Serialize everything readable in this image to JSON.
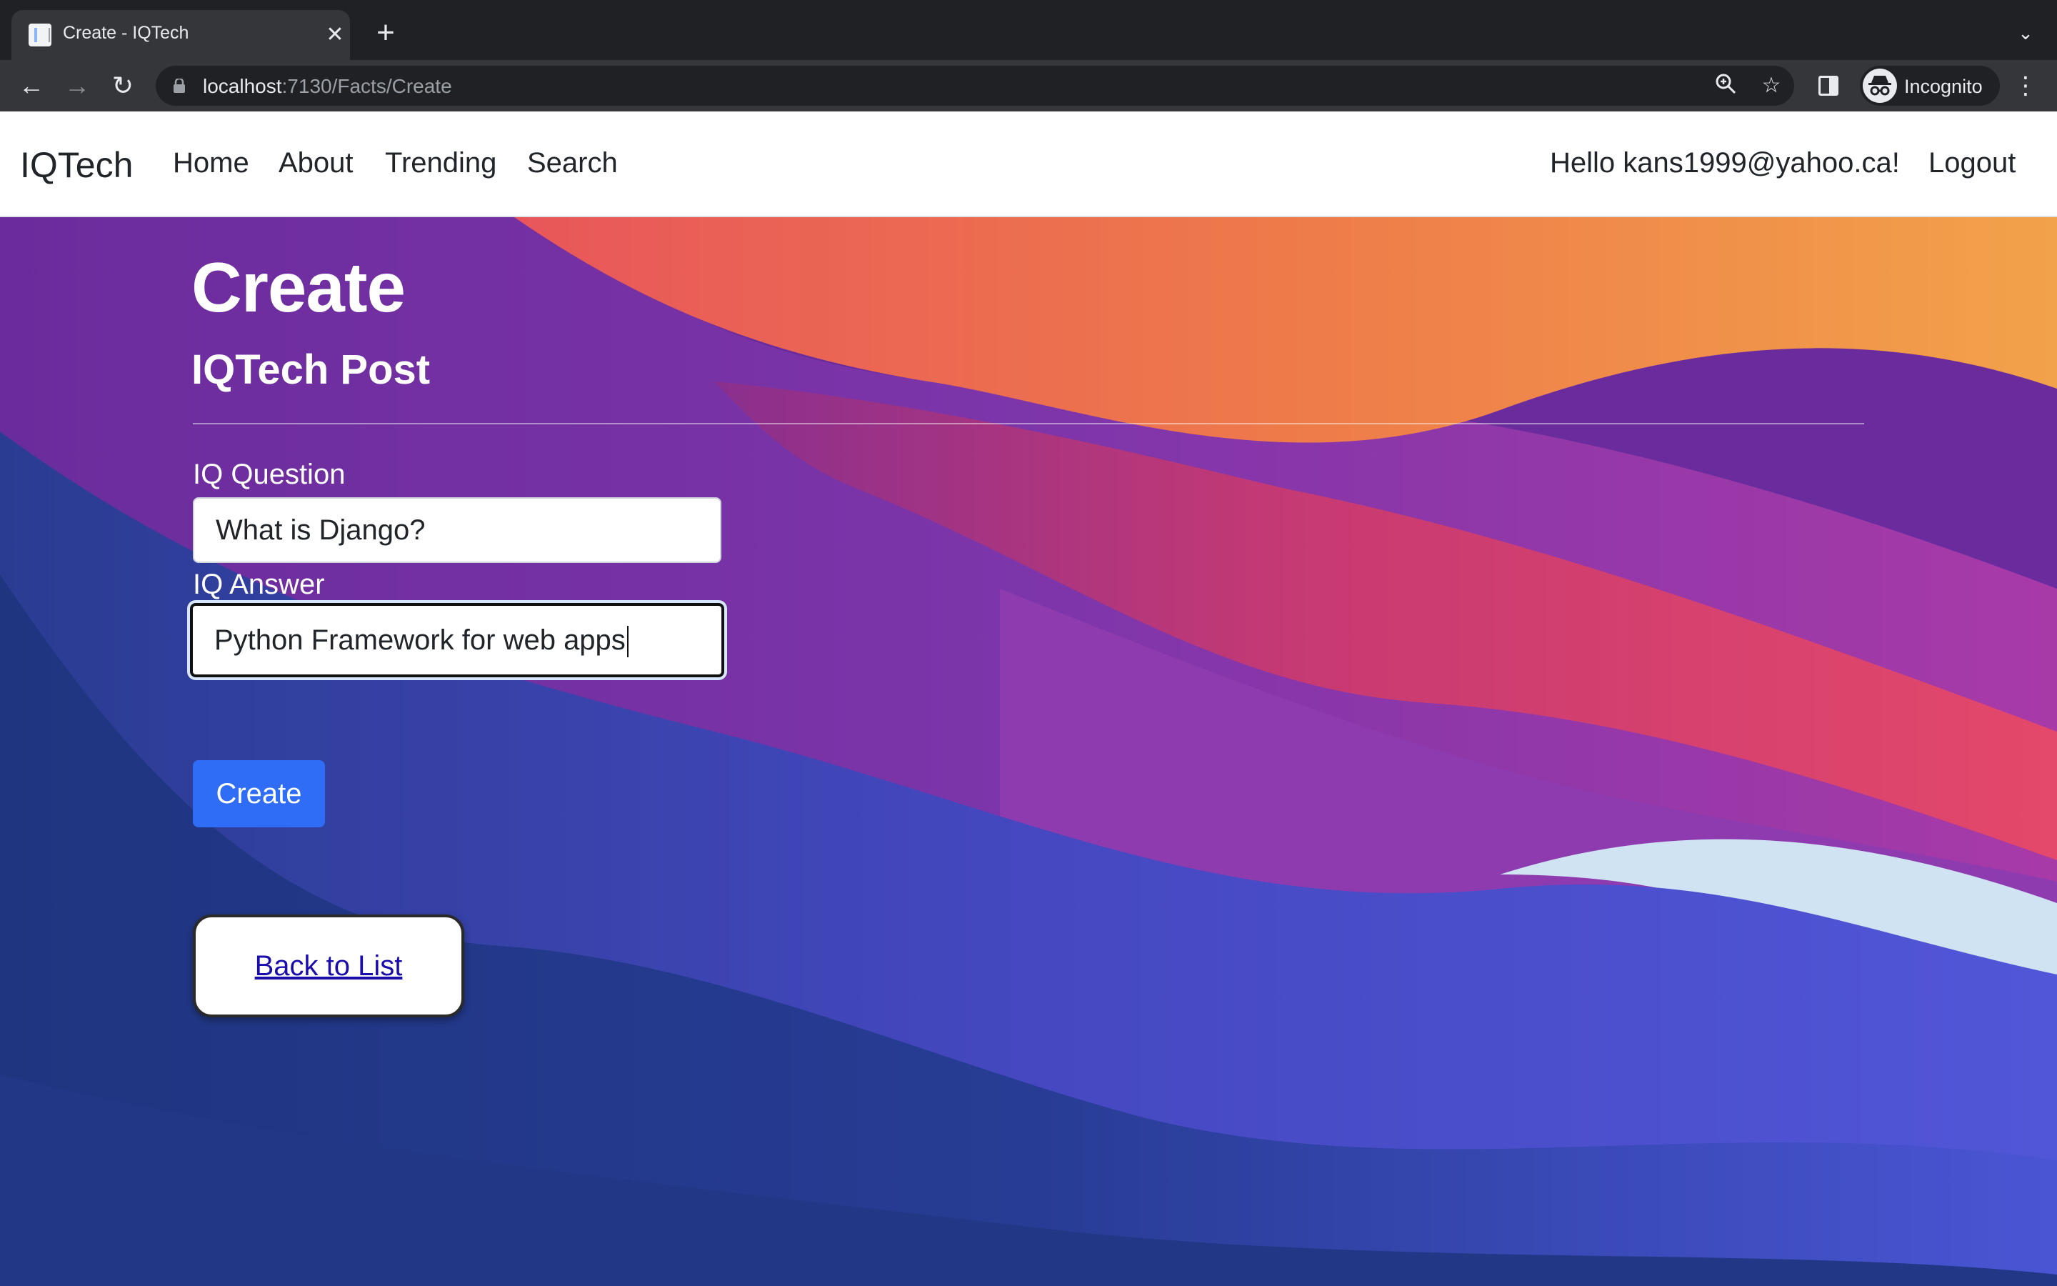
{
  "browser": {
    "tab_title": "Create - IQTech",
    "tab_close": "✕",
    "new_tab": "+",
    "tab_menu": "⌄",
    "url_host": "localhost",
    "url_path": ":7130/Facts/Create",
    "profile_label": "Incognito",
    "icons": [
      "back-icon",
      "forward-icon",
      "reload-icon",
      "lock-icon",
      "zoom-icon",
      "bookmark-star-icon",
      "side-panel-icon",
      "incognito-icon",
      "menu-icon"
    ]
  },
  "navbar": {
    "brand": "IQTech",
    "links": [
      "Home",
      "About",
      "Trending",
      "Search"
    ],
    "greeting": "Hello kans1999@yahoo.ca!",
    "logout": "Logout"
  },
  "page": {
    "title": "Create",
    "subtitle": "IQTech Post",
    "question_label": "IQ Question",
    "question_value": "What is Django?",
    "answer_label": "IQ Answer",
    "answer_value": "Python Framework for web apps",
    "submit_label": "Create",
    "back_link": "Back to List"
  },
  "colors": {
    "primary_button": "#2f6df6",
    "link": "#1a0dab",
    "background_base": "#1f3580"
  }
}
